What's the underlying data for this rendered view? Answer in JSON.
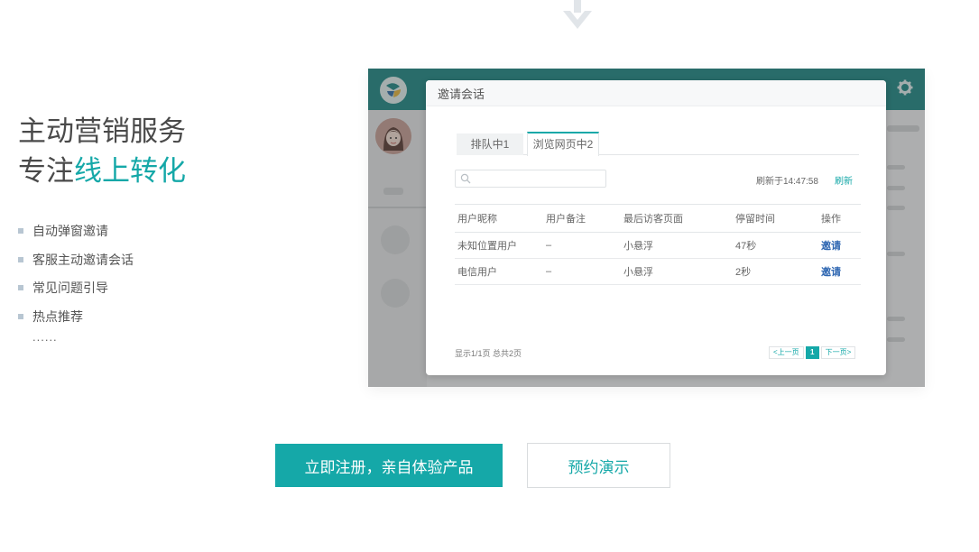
{
  "hero": {
    "title_line1": "主动营销服务",
    "title_line2_prefix": "专注",
    "title_line2_accent": "线上转化"
  },
  "features": {
    "items": [
      "自动弹窗邀请",
      "客服主动邀请会话",
      "常见问题引导",
      "热点推荐"
    ],
    "more": "......"
  },
  "dialog": {
    "title": "邀请会话",
    "tabs": [
      {
        "label": "排队中1"
      },
      {
        "label": "浏览网页中2",
        "active": true
      }
    ],
    "search": {
      "placeholder": ""
    },
    "refresh_time": "刷新于14:47:58",
    "refresh_label": "刷新",
    "table": {
      "columns": [
        "用户昵称",
        "用户备注",
        "最后访客页面",
        "停留时间",
        "操作"
      ],
      "rows": [
        [
          "未知位置用户",
          "–",
          "小悬浮",
          "47秒",
          "邀请"
        ],
        [
          "电信用户",
          "–",
          "小悬浮",
          "2秒",
          "邀请"
        ]
      ]
    },
    "page_info": "显示1/1页 总共2页",
    "pager": {
      "prev": "<上一页",
      "current": "1",
      "next": "下一页>"
    }
  },
  "cta": {
    "register_label": "立即注册，亲自体验产品",
    "demo_label": "预约演示"
  },
  "colors": {
    "accent": "#15a8a8",
    "topbar": "#1e8a86",
    "invite_link": "#2f67b2"
  },
  "icons": [
    "arrow-down-icon",
    "app-logo-icon",
    "gear-icon",
    "agent-avatar",
    "search-icon"
  ]
}
